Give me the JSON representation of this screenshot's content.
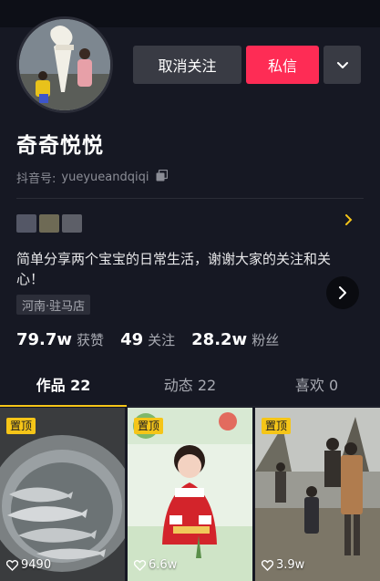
{
  "profile": {
    "name": "奇奇悦悦",
    "douyin_id_label": "抖音号:",
    "douyin_id": "yueyueandqiqi",
    "bio": "简单分享两个宝宝的日常生活，谢谢大家的关注和关心！",
    "location": "河南·驻马店"
  },
  "actions": {
    "unfollow_label": "取消关注",
    "message_label": "私信"
  },
  "stats": [
    {
      "value": "79.7w",
      "label": "获赞"
    },
    {
      "value": "49",
      "label": "关注"
    },
    {
      "value": "28.2w",
      "label": "粉丝"
    }
  ],
  "tabs": [
    {
      "label": "作品 22",
      "active": true
    },
    {
      "label": "动态 22",
      "active": false
    },
    {
      "label": "喜欢 0",
      "active": false
    }
  ],
  "videos": [
    {
      "pinned_label": "置顶",
      "likes": "9490"
    },
    {
      "pinned_label": "置顶",
      "likes": "6.6w"
    },
    {
      "pinned_label": "置顶",
      "likes": "3.9w"
    }
  ],
  "colors": {
    "background": "#161823",
    "accent_red": "#fe2c55",
    "accent_yellow": "#f5c518",
    "secondary_button": "#393b44"
  },
  "icons": {
    "copy": "copy-icon",
    "more": "chevron-down-icon",
    "link_arrow": "chevron-right-icon",
    "heart": "heart-icon"
  }
}
